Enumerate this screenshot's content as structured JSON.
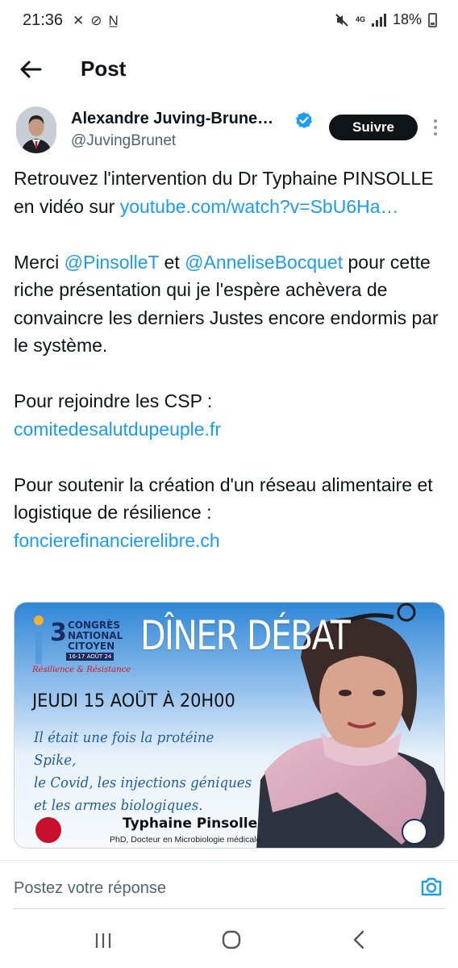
{
  "status_bar": {
    "time": "21:36",
    "left_icons": [
      "call-muted-icon",
      "no-disturb-icon",
      "n-icon"
    ],
    "left_glyphs": [
      "✕",
      "⊘",
      "N̲"
    ],
    "network": "4G",
    "battery": "18%"
  },
  "header": {
    "title": "Post"
  },
  "author": {
    "name": "Alexandre Juving-Brune…",
    "handle": "@JuvingBrunet",
    "verified": true,
    "follow_label": "Suivre"
  },
  "tweet": {
    "p1_before": "Retrouvez l'intervention du Dr Typhaine PINSOLLE en vidéo sur ",
    "p1_link": "youtube.com/watch?v=SbU6Ha…",
    "p2_start": "Merci ",
    "p2_mention1": "@PinsolleT",
    "p2_mid": " et ",
    "p2_mention2": "@AnneliseBocquet",
    "p2_end": " pour cette riche présentation qui je l'espère achèvera de convaincre les derniers Justes encore endormis par le système.",
    "p3_text": "Pour rejoindre les CSP :",
    "p3_link": "comitedesalutdupeuple.fr",
    "p4_text": "Pour soutenir la création d'un réseau alimentaire et logistique de résilience :",
    "p4_link": "foncierefinancierelibre.ch"
  },
  "media": {
    "congres_number": "3",
    "congres_lines": [
      "CONGRÈS",
      "NATIONAL",
      "CITOYEN"
    ],
    "congres_dates": "16-17 AOÛT 24",
    "congres_tagline": "Résilience & Résistance",
    "headline": "DÎNER DÉBAT",
    "date_line": "JEUDI 15 AOÛT À 20H00",
    "italic_lines": [
      "Il était une fois la protéine Spike,",
      "le Covid, les injections géniques",
      "et les armes biologiques."
    ],
    "speaker_name": "Typhaine Pinsolle",
    "speaker_title": "PhD, Docteur en Microbiologie médicale",
    "colors": {
      "sky_top": "#2f86d6",
      "sky_bottom": "#e8f1fa",
      "headline": "#ffffff",
      "italic": "#1f5f9e",
      "brand_red": "#c8102e"
    }
  },
  "reply": {
    "placeholder": "Postez votre réponse"
  },
  "nav": {
    "icons": [
      "recent-apps-icon",
      "home-icon",
      "back-icon"
    ]
  }
}
